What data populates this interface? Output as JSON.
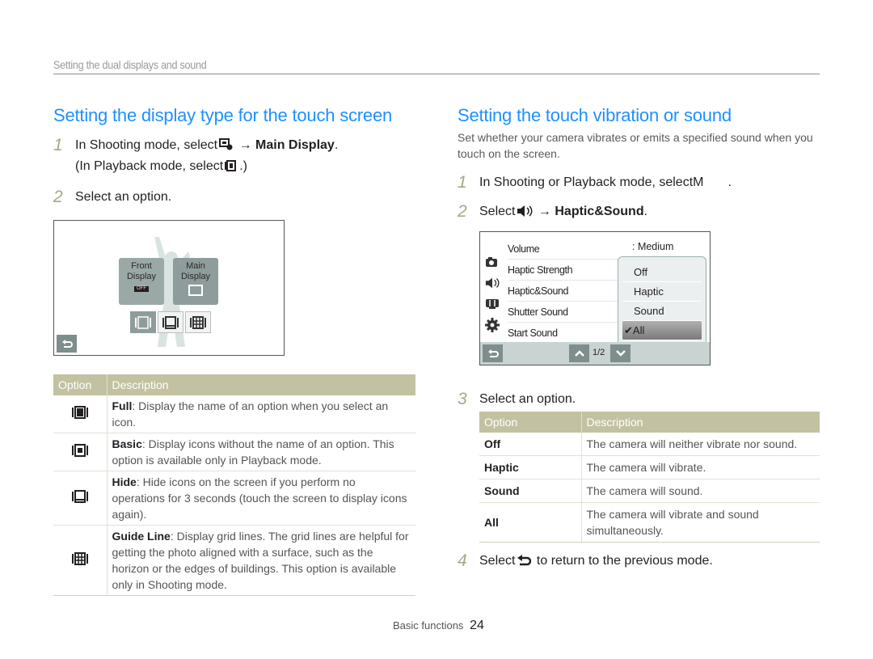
{
  "running_head": "Setting the dual displays and sound",
  "left": {
    "title": "Setting the display type for the touch screen",
    "steps": [
      {
        "num": "1",
        "pre": "In Shooting mode, select",
        "arrow": "→",
        "bold": "Main Display",
        "post": ".",
        "line2_pre": "(In Playback mode, select",
        "line2_post": ".)"
      },
      {
        "num": "2",
        "text": "Select an option."
      }
    ],
    "screen": {
      "front_label_1": "Front",
      "front_label_2": "Display",
      "front_badge": "OFF",
      "main_label_1": "Main",
      "main_label_2": "Display"
    },
    "table": {
      "headers": [
        "Option",
        "Description"
      ],
      "rows": [
        {
          "icon": "display-full-icon",
          "name": "Full",
          "desc": ": Display the name of an option when you select an icon."
        },
        {
          "icon": "display-basic-icon",
          "name": "Basic",
          "desc": ": Display icons without the name of an option. This option is available only in Playback mode."
        },
        {
          "icon": "display-hide-icon",
          "name": "Hide",
          "desc": ": Hide icons on the screen if you perform no operations for 3 seconds (touch the screen to display icons again)."
        },
        {
          "icon": "guide-line-icon",
          "name": "Guide Line",
          "desc": ": Display grid lines. The grid lines are helpful for getting the photo aligned with a surface, such as the horizon or the edges of buildings. This option is available only in Shooting mode."
        }
      ]
    }
  },
  "right": {
    "title": "Setting the touch vibration or sound",
    "intro": "Set whether your camera vibrates or emits a specified sound when you touch on the screen.",
    "steps": [
      {
        "num": "1",
        "text": "In Shooting or Playback mode, select",
        "glyph": "M",
        "post": "."
      },
      {
        "num": "2",
        "pre": "Select",
        "arrow": "→",
        "bold": "Haptic&Sound",
        "post": "."
      },
      {
        "num": "3",
        "text": "Select an option."
      },
      {
        "num": "4",
        "pre": "Select",
        "post": "to return to the previous mode."
      }
    ],
    "screen": {
      "menu": [
        "Volume",
        "Haptic Strength",
        "Haptic&Sound",
        "Shutter Sound",
        "Start Sound"
      ],
      "volume_value": ": Medium",
      "popup": [
        {
          "label": "Off",
          "selected": false
        },
        {
          "label": "Haptic",
          "selected": false
        },
        {
          "label": "Sound",
          "selected": false
        },
        {
          "label": "All",
          "selected": true
        }
      ],
      "check": "✔",
      "page": "1/2"
    },
    "table": {
      "headers": [
        "Option",
        "Description"
      ],
      "rows": [
        {
          "name": "Off",
          "desc": "The camera will neither vibrate nor sound."
        },
        {
          "name": "Haptic",
          "desc": "The camera will vibrate."
        },
        {
          "name": "Sound",
          "desc": "The camera will sound."
        },
        {
          "name": "All",
          "desc": "The camera will vibrate and sound simultaneously."
        }
      ]
    }
  },
  "footer": {
    "section": "Basic functions",
    "page": "24"
  }
}
